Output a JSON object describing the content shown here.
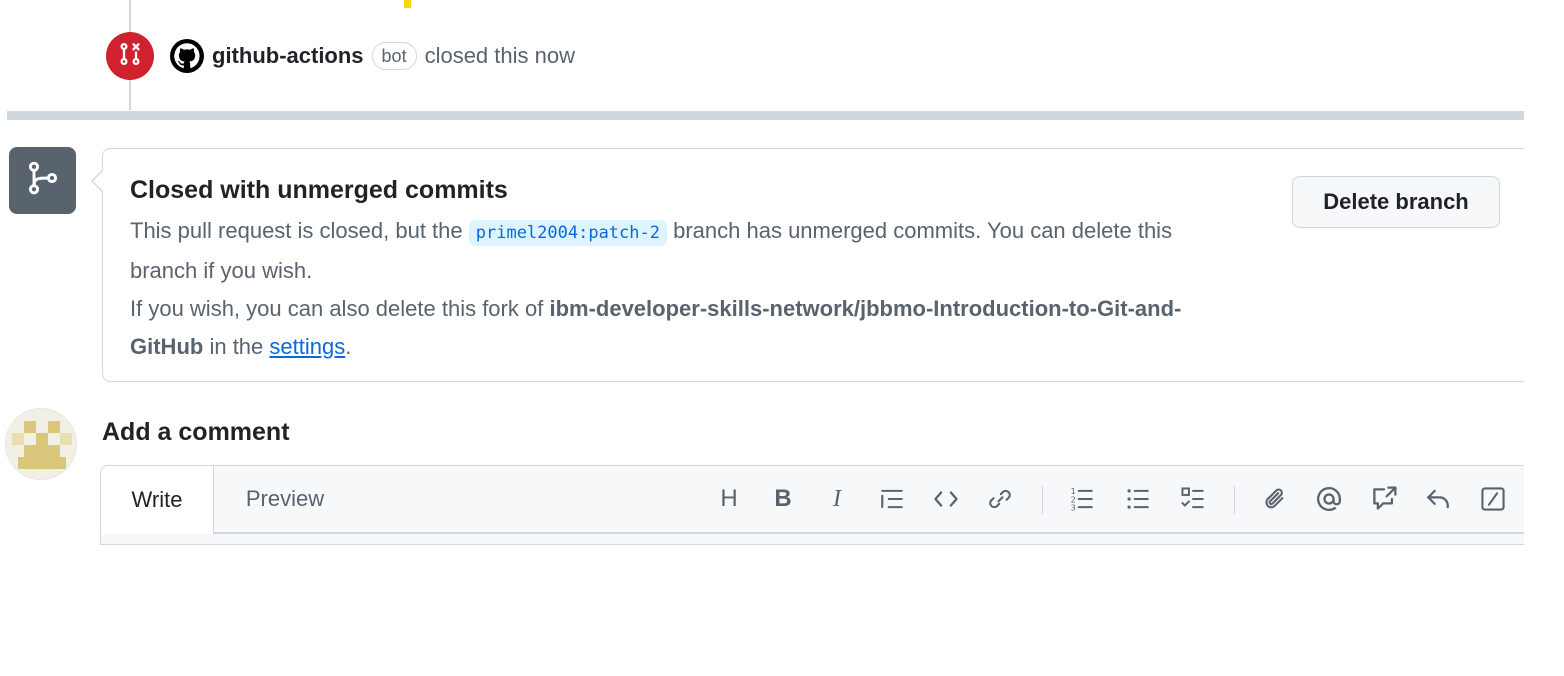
{
  "timeline_event": {
    "actor": "github-actions",
    "badge": "bot",
    "action_text": "closed this now"
  },
  "merge_box": {
    "title": "Closed with unmerged commits",
    "line1_prefix": "This pull request is closed, but the",
    "branch_ref": "primel2004:patch-2",
    "line1_suffix": "branch has unmerged commits. You can delete this branch if you wish.",
    "line2_prefix": "If you wish, you can also delete this fork of",
    "repo_name": "ibm-developer-skills-network/jbbmo-Introduction-to-Git-and-GitHub",
    "line2_middle": "in the",
    "settings_link": "settings",
    "line2_suffix": ".",
    "delete_button": "Delete branch"
  },
  "comment": {
    "heading": "Add a comment",
    "tabs": {
      "write": "Write",
      "preview": "Preview"
    },
    "toolbar": {
      "heading": "H",
      "bold": "B",
      "italic": "I"
    }
  },
  "colors": {
    "closed_red": "#cf222e",
    "muted_gray": "#59636e",
    "link_blue": "#0969da",
    "border": "#d0d7de"
  },
  "icons": [
    "git-pull-request-closed-icon",
    "github-mark-icon",
    "git-branch-icon",
    "heading-icon",
    "bold-icon",
    "italic-icon",
    "quote-icon",
    "code-icon",
    "link-icon",
    "ordered-list-icon",
    "unordered-list-icon",
    "task-list-icon",
    "paperclip-icon",
    "mention-icon",
    "cross-reference-icon",
    "reply-icon",
    "slash-command-icon"
  ]
}
